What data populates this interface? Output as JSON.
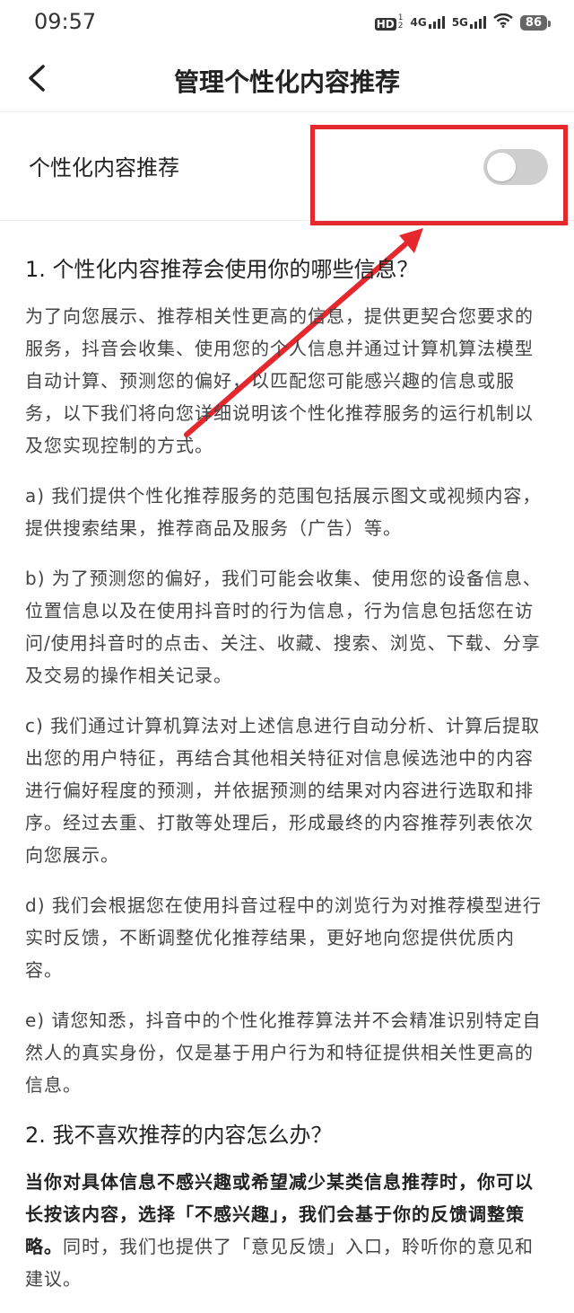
{
  "status_bar": {
    "time": "09:57",
    "hd": "HD",
    "sim1": "1",
    "sim2": "2",
    "net1": "4G",
    "net2": "5G",
    "battery": "86"
  },
  "nav": {
    "back_icon": "chevron-left-icon",
    "title": "管理个性化内容推荐"
  },
  "setting": {
    "label": "个性化内容推荐",
    "enabled": false
  },
  "annotation": {
    "box_color": "#e5282d",
    "arrow_color": "#e5282d"
  },
  "section1": {
    "heading": "1. 个性化内容推荐会使用你的哪些信息？",
    "intro": "为了向您展示、推荐相关性更高的信息，提供更契合您要求的服务，抖音会收集、使用您的个人信息并通过计算机算法模型自动计算、预测您的偏好，以匹配您可能感兴趣的信息或服务，以下我们将向您详细说明该个性化推荐服务的运行机制以及您实现控制的方式。",
    "a": "a) 我们提供个性化推荐服务的范围包括展示图文或视频内容，提供搜索结果，推荐商品及服务（广告）等。",
    "b": "b) 为了预测您的偏好，我们可能会收集、使用您的设备信息、位置信息以及在使用抖音时的行为信息，行为信息包括您在访问/使用抖音时的点击、关注、收藏、搜索、浏览、下载、分享及交易的操作相关记录。",
    "c": "c) 我们通过计算机算法对上述信息进行自动分析、计算后提取出您的用户特征，再结合其他相关特征对信息候选池中的内容进行偏好程度的预测，并依据预测的结果对内容进行选取和排序。经过去重、打散等处理后，形成最终的内容推荐列表依次向您展示。",
    "d": "d) 我们会根据您在使用抖音过程中的浏览行为对推荐模型进行实时反馈，不断调整优化推荐结果，更好地向您提供优质内容。",
    "e": "e) 请您知悉，抖音中的个性化推荐算法并不会精准识别特定自然人的真实身份，仅是基于用户行为和特征提供相关性更高的信息。"
  },
  "section2": {
    "heading": "2. 我不喜欢推荐的内容怎么办？",
    "bold": "当你对具体信息不感兴趣或希望减少某类信息推荐时，你可以长按该内容，选择「不感兴趣」，我们会基于你的反馈调整策略。",
    "rest": "同时，我们也提供了「意见反馈」入口，聆听你的意见和建议。"
  }
}
